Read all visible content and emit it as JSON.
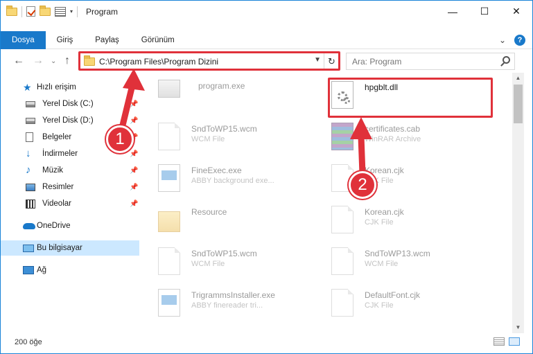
{
  "window": {
    "title": "Program"
  },
  "titlebar": {
    "minimize": "—",
    "maximize": "☐",
    "close": "✕"
  },
  "ribbon": {
    "tabs": [
      {
        "label": "Dosya",
        "active": true
      },
      {
        "label": "Giriş",
        "active": false
      },
      {
        "label": "Paylaş",
        "active": false
      },
      {
        "label": "Görünüm",
        "active": false
      }
    ],
    "expand": "⌄",
    "help": "?"
  },
  "nav": {
    "back": "←",
    "forward": "→",
    "history": "⌄",
    "up": "↑",
    "address": "C:\\Program Files\\Program Dizini",
    "refresh": "↻",
    "search_placeholder": "Ara: Program"
  },
  "sidebar": {
    "quick_access": "Hızlı erişim",
    "items": [
      {
        "label": "Yerel Disk (C:)",
        "icon": "disk-icon",
        "pinned": true
      },
      {
        "label": "Yerel Disk (D:)",
        "icon": "disk-icon",
        "pinned": true
      },
      {
        "label": "Belgeler",
        "icon": "documents-icon",
        "pinned": true
      },
      {
        "label": "İndirmeler",
        "icon": "download-icon",
        "pinned": true
      },
      {
        "label": "Müzik",
        "icon": "music-icon",
        "pinned": true
      },
      {
        "label": "Resimler",
        "icon": "pictures-icon",
        "pinned": true
      },
      {
        "label": "Videolar",
        "icon": "videos-icon",
        "pinned": true
      }
    ],
    "onedrive": "OneDrive",
    "this_pc": "Bu bilgisayar",
    "network": "Ağ"
  },
  "files": {
    "left": [
      {
        "name": "program.exe",
        "type": ""
      },
      {
        "name": "SndToWP15.wcm",
        "type": "WCM File"
      },
      {
        "name": "FineExec.exe",
        "type": "ABBY background exe..."
      },
      {
        "name": "Resource",
        "type": ""
      },
      {
        "name": "SndToWP15.wcm",
        "type": "WCM File"
      },
      {
        "name": "TrigrammsInstaller.exe",
        "type": "ABBY finereader tri..."
      }
    ],
    "right": [
      {
        "name": "hpgblt.dll",
        "type": ""
      },
      {
        "name": "certificates.cab",
        "type": "WinRAR Archive"
      },
      {
        "name": "Korean.cjk",
        "type": "CJK File"
      },
      {
        "name": "Korean.cjk",
        "type": "CJK File"
      },
      {
        "name": "SndToWP13.wcm",
        "type": "WCM File"
      },
      {
        "name": "DefaultFont.cjk",
        "type": "CJK File"
      }
    ]
  },
  "annotations": {
    "step1": "1",
    "step2": "2"
  },
  "status": {
    "item_count": "200 öğe"
  },
  "colors": {
    "accent": "#1979ca",
    "highlight": "#e0313a",
    "selected": "#cce8ff"
  }
}
